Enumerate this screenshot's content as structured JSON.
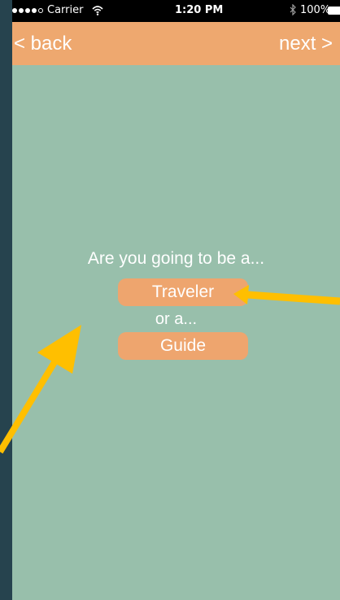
{
  "status_bar": {
    "carrier": "Carrier",
    "time": "1:20 PM",
    "battery": "100%",
    "signal_icon": "signal-icon",
    "wifi_icon": "wifi-icon",
    "bluetooth_icon": "bluetooth-icon",
    "battery_icon": "battery-icon"
  },
  "nav": {
    "back": "< back",
    "next": "next >"
  },
  "content": {
    "question": "Are you going to be a...",
    "traveler": "Traveler",
    "or_text": "or a...",
    "guide": "Guide"
  },
  "colors": {
    "background": "#98bfab",
    "accent": "#eea86f",
    "annotation_arrow": "#ffbf00",
    "outer_background": "#26434e"
  }
}
